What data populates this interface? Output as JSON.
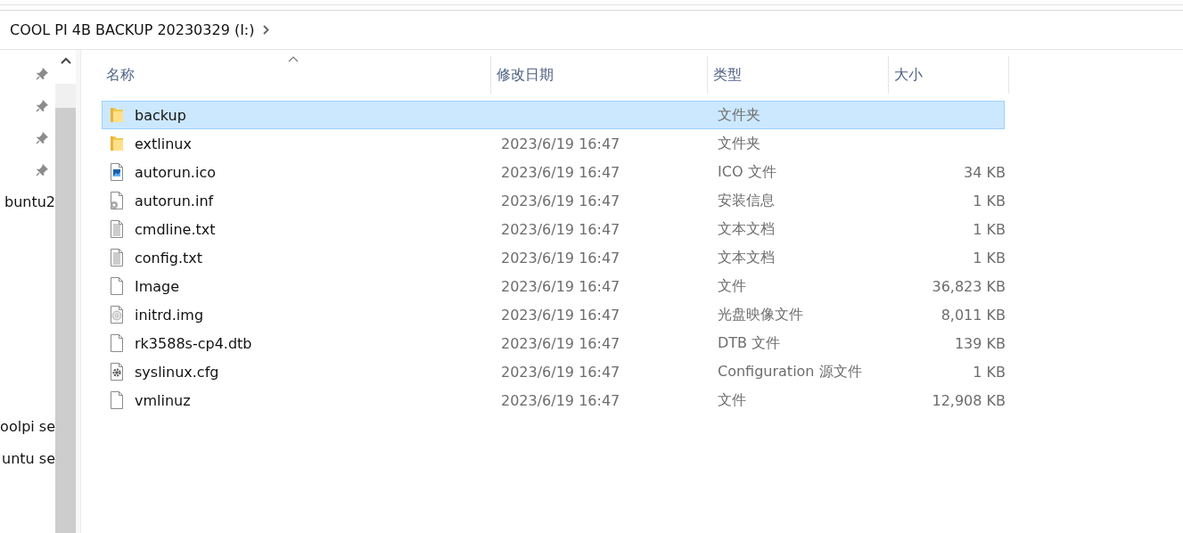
{
  "address_bar": {
    "path": "COOL PI 4B BACKUP 20230329 (I:)"
  },
  "nav_pane": {
    "items": [
      {
        "kind": "pin"
      },
      {
        "kind": "pin"
      },
      {
        "kind": "pin"
      },
      {
        "kind": "pin"
      },
      {
        "kind": "text",
        "label": "buntu2"
      },
      {
        "kind": "gap"
      },
      {
        "kind": "gap"
      },
      {
        "kind": "gap"
      },
      {
        "kind": "gap"
      },
      {
        "kind": "gap"
      },
      {
        "kind": "gap"
      },
      {
        "kind": "text",
        "label": "oolpi se"
      },
      {
        "kind": "text",
        "label": "untu se"
      }
    ]
  },
  "table": {
    "columns": [
      "名称",
      "修改日期",
      "类型",
      "大小"
    ],
    "rows": [
      {
        "kind": "folder",
        "name": "backup",
        "date": "",
        "type": "文件夹",
        "size": "",
        "selected": true
      },
      {
        "kind": "folder",
        "name": "extlinux",
        "date": "2023/6/19 16:47",
        "type": "文件夹",
        "size": "",
        "selected": false
      },
      {
        "kind": "image",
        "name": "autorun.ico",
        "date": "2023/6/19 16:47",
        "type": "ICO 文件",
        "size": "34 KB",
        "selected": false
      },
      {
        "kind": "setup",
        "name": "autorun.inf",
        "date": "2023/6/19 16:47",
        "type": "安装信息",
        "size": "1 KB",
        "selected": false
      },
      {
        "kind": "text",
        "name": "cmdline.txt",
        "date": "2023/6/19 16:47",
        "type": "文本文档",
        "size": "1 KB",
        "selected": false
      },
      {
        "kind": "text",
        "name": "config.txt",
        "date": "2023/6/19 16:47",
        "type": "文本文档",
        "size": "1 KB",
        "selected": false
      },
      {
        "kind": "blank",
        "name": "Image",
        "date": "2023/6/19 16:47",
        "type": "文件",
        "size": "36,823 KB",
        "selected": false
      },
      {
        "kind": "disc",
        "name": "initrd.img",
        "date": "2023/6/19 16:47",
        "type": "光盘映像文件",
        "size": "8,011 KB",
        "selected": false
      },
      {
        "kind": "blank",
        "name": "rk3588s-cp4.dtb",
        "date": "2023/6/19 16:47",
        "type": "DTB 文件",
        "size": "139 KB",
        "selected": false
      },
      {
        "kind": "config",
        "name": "syslinux.cfg",
        "date": "2023/6/19 16:47",
        "type": "Configuration 源文件",
        "size": "1 KB",
        "selected": false
      },
      {
        "kind": "blank",
        "name": "vmlinuz",
        "date": "2023/6/19 16:47",
        "type": "文件",
        "size": "12,908 KB",
        "selected": false
      }
    ]
  }
}
